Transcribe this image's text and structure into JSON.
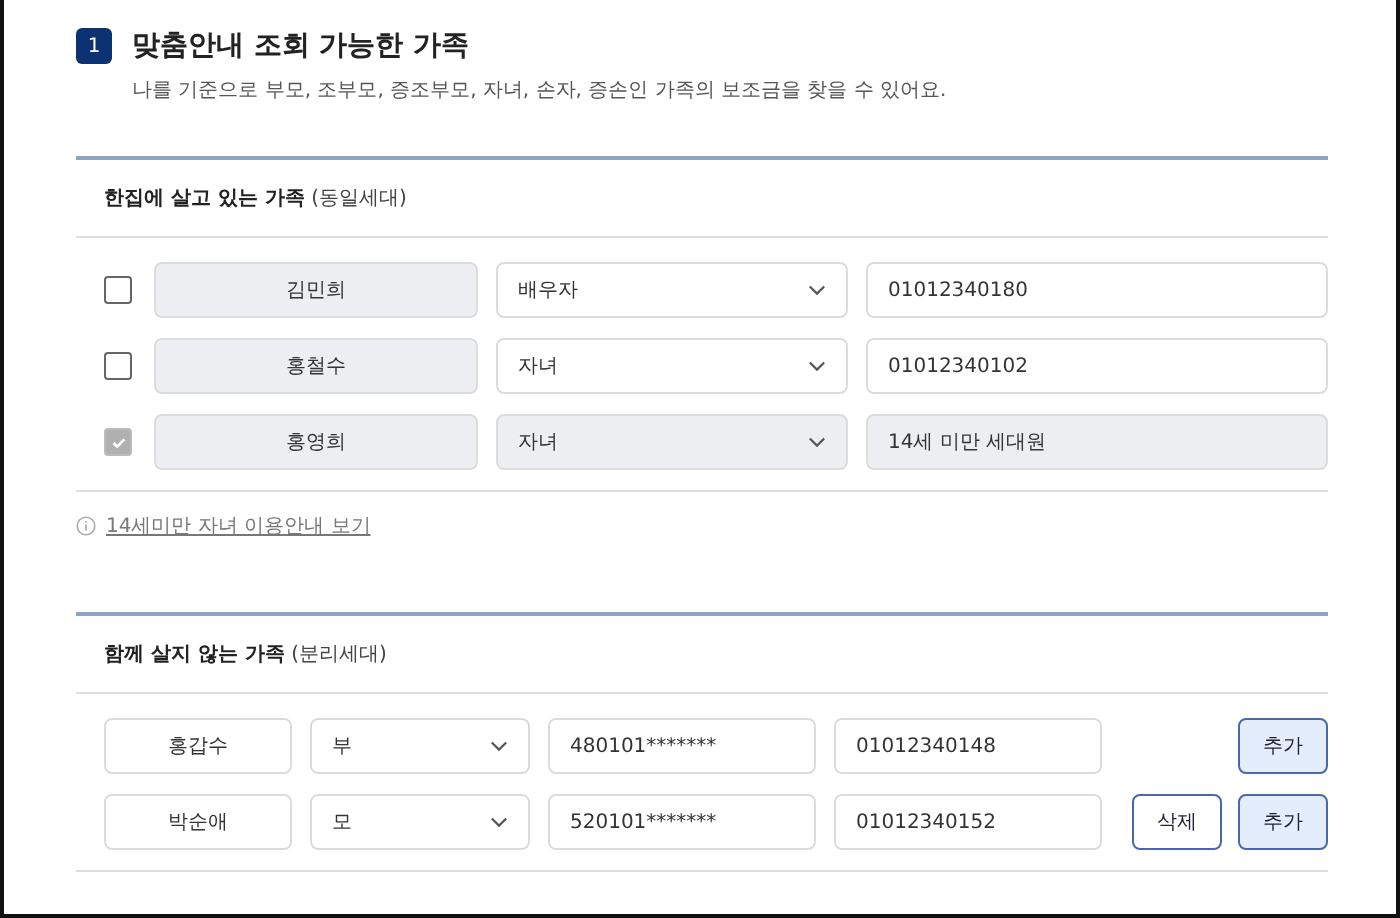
{
  "section": {
    "number": "1",
    "title": "맞춤안내 조회 가능한 가족",
    "description": "나를 기준으로 부모, 조부모, 증조부모, 자녀, 손자, 증손인 가족의 보조금을 찾을 수 있어요."
  },
  "groups": [
    {
      "kind": "household",
      "title": "**한집에 살고 있는 가족** (동일세대)",
      "note": "14세미만 자녀 이용안내 보기",
      "rows": [
        {
          "checked": false,
          "disabled": false,
          "name": "김민희",
          "relation": "배우자",
          "phone": "01012340180"
        },
        {
          "checked": false,
          "disabled": false,
          "name": "홍철수",
          "relation": "자녀",
          "phone": "01012340102"
        },
        {
          "checked": true,
          "disabled": true,
          "name": "홍영희",
          "relation": "자녀",
          "phone": "14세 미만 세대원"
        }
      ]
    },
    {
      "kind": "separate",
      "title": "**함께 살지 않는 가족** (분리세대)",
      "rows": [
        {
          "name": "홍갑수",
          "relation": "부",
          "id": "480101*******",
          "phone": "01012340148",
          "buttons": [
            {
              "kind": "add",
              "label": "추가"
            }
          ]
        },
        {
          "name": "박순애",
          "relation": "모",
          "id": "520101*******",
          "phone": "01012340152",
          "buttons": [
            {
              "kind": "delete",
              "label": "삭제"
            },
            {
              "kind": "add",
              "label": "추가"
            }
          ]
        }
      ]
    }
  ]
}
